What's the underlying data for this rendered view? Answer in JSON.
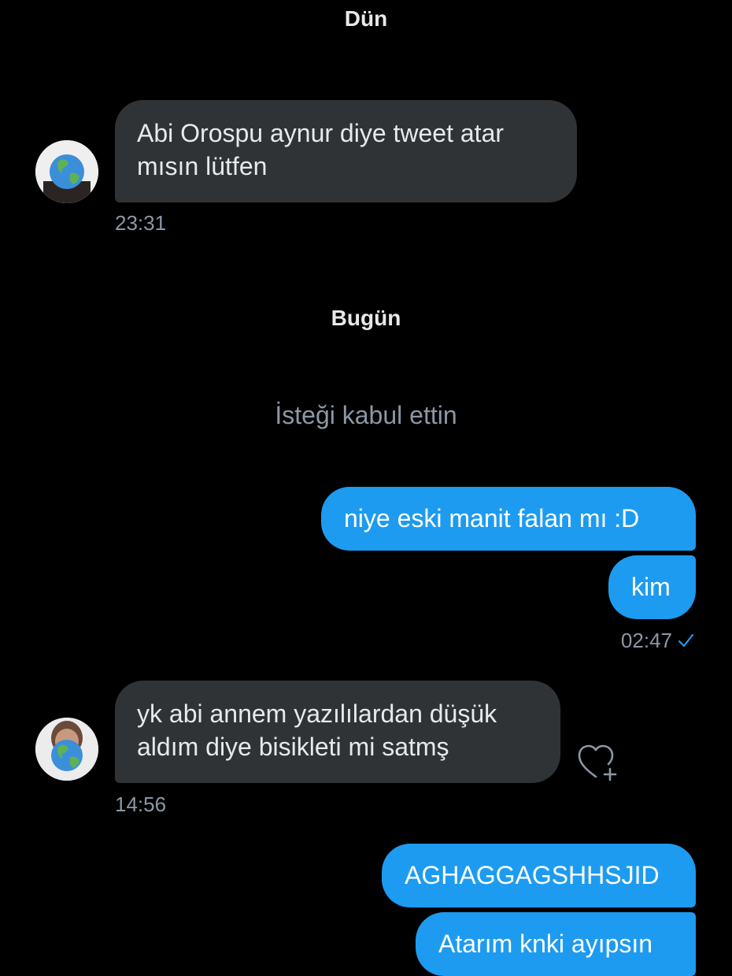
{
  "conversation": {
    "day_separators": {
      "yesterday": "Dün",
      "today": "Bugün"
    },
    "system_note": "İsteği kabul ettin",
    "messages": [
      {
        "direction": "incoming",
        "text": "Abi Orospu aynur diye tweet atar\nmısın lütfen",
        "time": "23:31"
      },
      {
        "direction": "outgoing",
        "text": "niye eski manit falan mı :D"
      },
      {
        "direction": "outgoing",
        "text": "kim",
        "time": "02:47",
        "status": "check-icon"
      },
      {
        "direction": "incoming",
        "text": "yk abi annem yazılılardan düşük\naldım diye bisikleti mi satmş",
        "time": "14:56",
        "reaction_button_icon": "heart-plus-icon"
      },
      {
        "direction": "outgoing",
        "text": "AGHAGGAGSHHSJID"
      },
      {
        "direction": "outgoing",
        "text": "Atarım knki ayıpsın"
      }
    ]
  },
  "colors": {
    "background": "#000000",
    "incoming_bubble": "#2f3336",
    "outgoing_bubble": "#1d9bf0",
    "muted_text": "#8b98a5",
    "primary_text": "#e7e9ea"
  }
}
